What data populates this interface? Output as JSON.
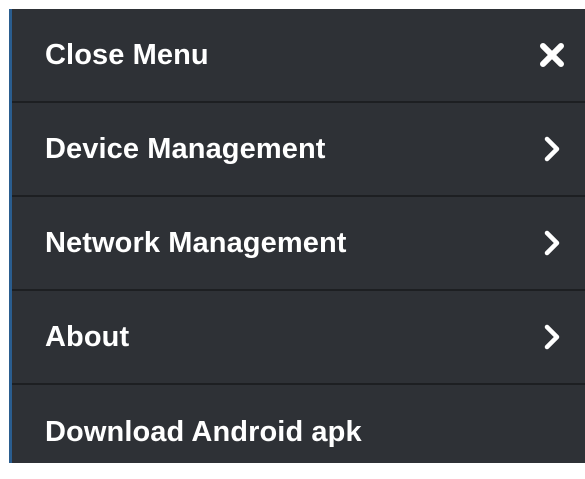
{
  "menu": {
    "items": [
      {
        "label": "Close Menu",
        "icon": "close-icon"
      },
      {
        "label": "Device Management",
        "icon": "chevron-right-icon"
      },
      {
        "label": "Network Management",
        "icon": "chevron-right-icon"
      },
      {
        "label": "About",
        "icon": "chevron-right-icon"
      },
      {
        "label": "Download Android apk",
        "icon": null
      }
    ]
  },
  "colors": {
    "background": "#2e3136",
    "divider": "#1d1f22",
    "text": "#ffffff",
    "accent_edge": "#2a5d8f"
  }
}
